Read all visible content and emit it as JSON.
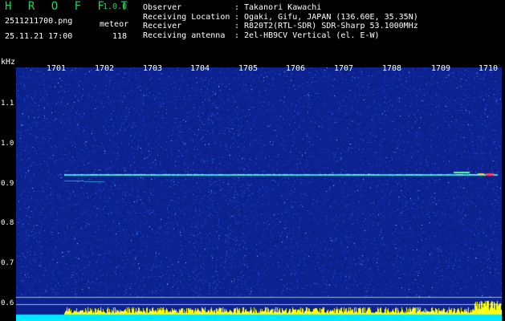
{
  "header": {
    "brand": "H R O F F T",
    "version": "1.0.0",
    "filename": "2511211700.png",
    "plot_type": "meteor",
    "datetime": "25.11.21 17:00",
    "count": "118"
  },
  "info": [
    {
      "label": "Observer",
      "value": "Takanori Kawachi"
    },
    {
      "label": "Receiving Location",
      "value": "Ogaki, Gifu, JAPAN (136.60E, 35.35N)"
    },
    {
      "label": "Receiver",
      "value": "R820T2(RTL-SDR) SDR-Sharp 53.1000MHz"
    },
    {
      "label": "Receiving antenna",
      "value": "2el-HB9CV Vertical (el. E-W)"
    }
  ],
  "separator": ":",
  "axis": {
    "y_unit": "kHz",
    "y_ticks": [
      "1.1",
      "1.0",
      "0.9",
      "0.8",
      "0.7",
      "0.6"
    ],
    "x_ticks": [
      "1701",
      "1702",
      "1703",
      "1704",
      "1705",
      "1706",
      "1707",
      "1708",
      "1709",
      "1710"
    ]
  },
  "colors": {
    "background": "#000000",
    "noise_low": "#0a1a7a",
    "noise_high": "#2244dd",
    "carrier": "#30e0e0",
    "brand_green": "#20d060",
    "bottom_bar": "#ffff00",
    "bottom_base": "#00ffff"
  }
}
